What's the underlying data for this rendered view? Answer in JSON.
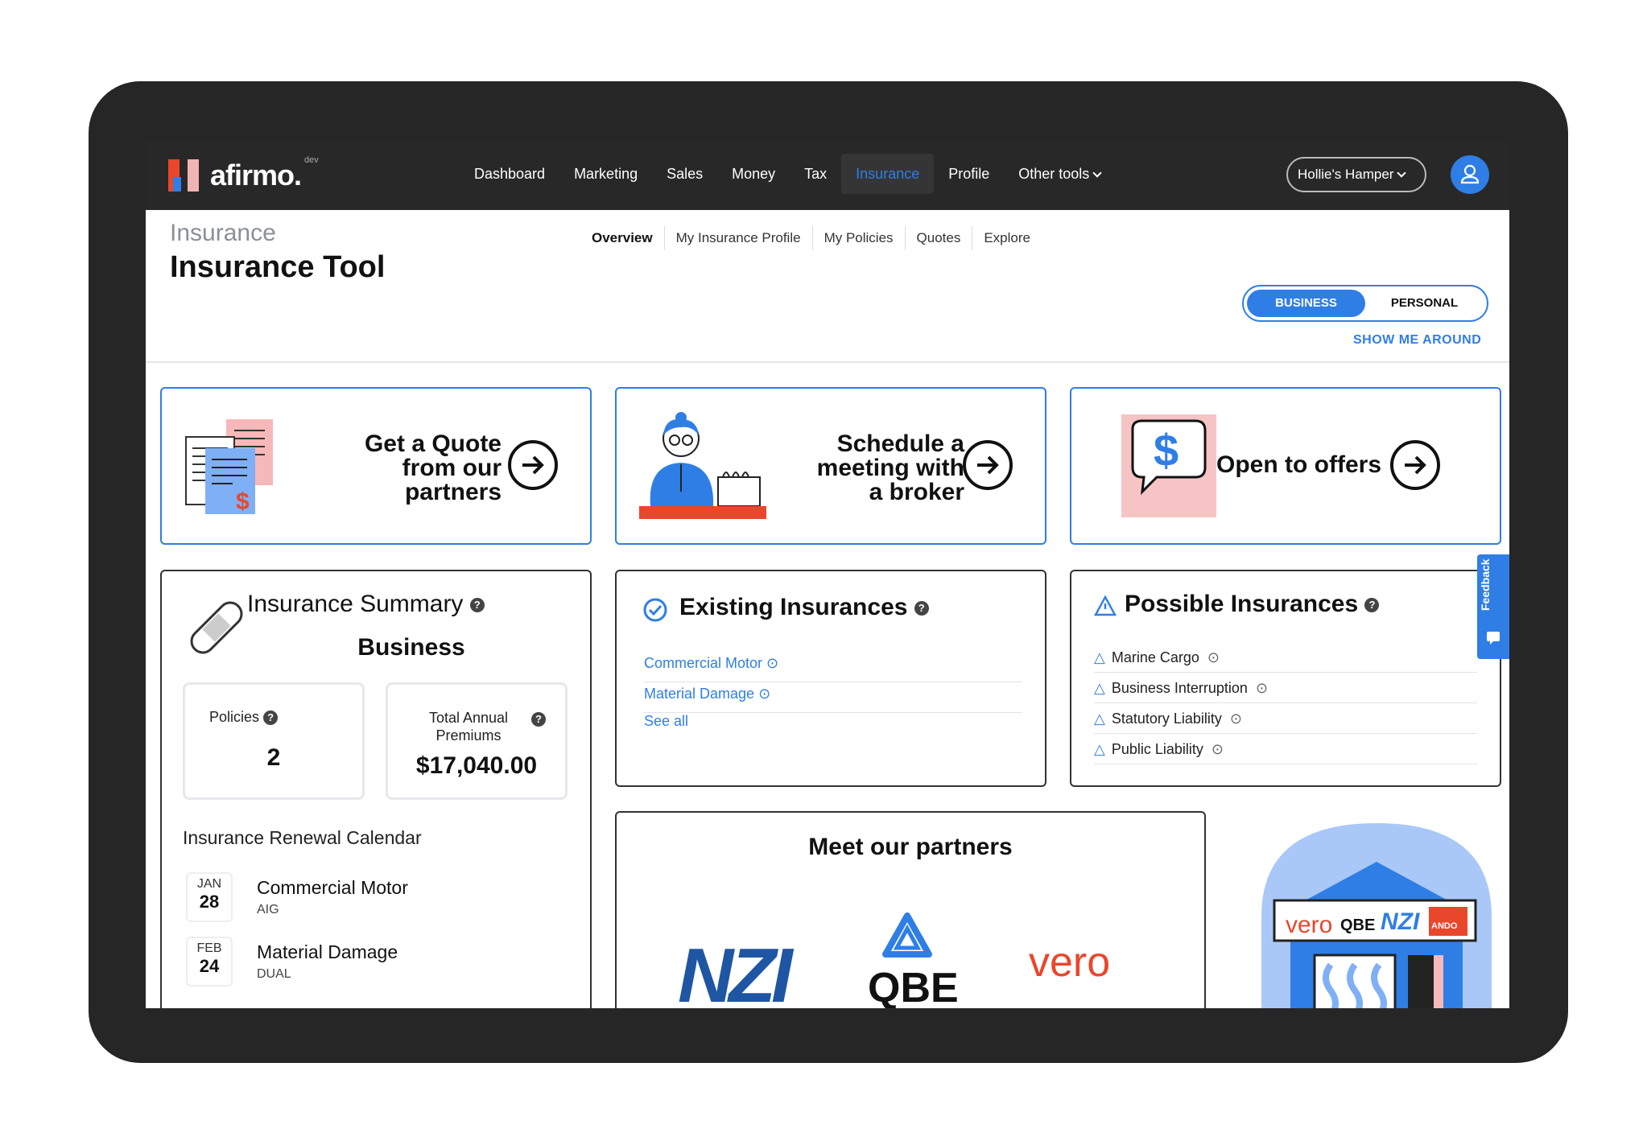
{
  "app": {
    "logo": "afirmo.",
    "logo_tag": "dev"
  },
  "nav": {
    "items": [
      {
        "label": "Dashboard",
        "active": false
      },
      {
        "label": "Marketing",
        "active": false
      },
      {
        "label": "Sales",
        "active": false
      },
      {
        "label": "Money",
        "active": false
      },
      {
        "label": "Tax",
        "active": false
      },
      {
        "label": "Insurance",
        "active": true
      },
      {
        "label": "Profile",
        "active": false
      },
      {
        "label": "Other tools",
        "active": false
      }
    ],
    "business": "Hollie's Hamper"
  },
  "header": {
    "breadcrumb": "Insurance",
    "title": "Insurance Tool",
    "tabs": [
      "Overview",
      "My Insurance Profile",
      "My Policies",
      "Quotes",
      "Explore"
    ],
    "toggle": {
      "business": "BUSINESS",
      "personal": "PERSONAL"
    },
    "show_me": "SHOW ME AROUND"
  },
  "actions": {
    "quote": [
      "Get a Quote",
      "from our",
      "partners"
    ],
    "meeting": [
      "Schedule a",
      "meeting with",
      "a broker"
    ],
    "offers": "Open to offers"
  },
  "summary": {
    "title": "Insurance Summary",
    "subtitle": "Business",
    "policies_label": "Policies",
    "policies_value": "2",
    "premiums_label_1": "Total Annual",
    "premiums_label_2": "Premiums",
    "premiums_value": "$17,040.00",
    "calendar_title": "Insurance Renewal Calendar",
    "renewals": [
      {
        "month": "JAN",
        "day": "28",
        "name": "Commercial Motor",
        "insurer": "AIG"
      },
      {
        "month": "FEB",
        "day": "24",
        "name": "Material Damage",
        "insurer": "DUAL"
      }
    ]
  },
  "existing": {
    "title": "Existing Insurances",
    "items": [
      "Commercial Motor",
      "Material Damage"
    ],
    "see_all": "See all"
  },
  "possible": {
    "title": "Possible Insurances",
    "items": [
      "Marine Cargo",
      "Business Interruption",
      "Statutory Liability",
      "Public Liability"
    ]
  },
  "partners": {
    "title": "Meet our partners",
    "logos": [
      "NZI",
      "QBE",
      "vero"
    ],
    "ando": "ANDO"
  },
  "feedback": "Feedback",
  "colors": {
    "accent": "#2f7ee6",
    "topbar": "#282828",
    "brand_red": "#e8472c"
  }
}
